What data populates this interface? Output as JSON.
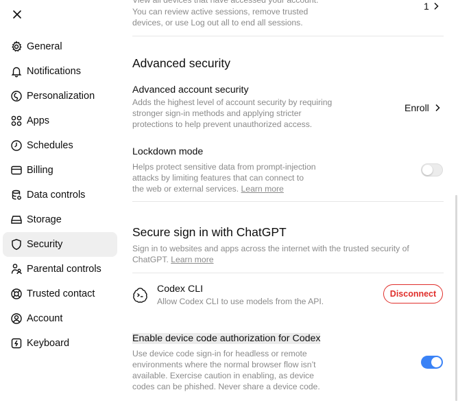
{
  "sidebar": {
    "items": [
      {
        "label": "General",
        "icon": "gear-icon"
      },
      {
        "label": "Notifications",
        "icon": "bell-icon"
      },
      {
        "label": "Personalization",
        "icon": "personalization-icon"
      },
      {
        "label": "Apps",
        "icon": "apps-grid-icon"
      },
      {
        "label": "Schedules",
        "icon": "clock-icon"
      },
      {
        "label": "Billing",
        "icon": "credit-card-icon"
      },
      {
        "label": "Data controls",
        "icon": "database-icon"
      },
      {
        "label": "Storage",
        "icon": "storage-icon"
      },
      {
        "label": "Security",
        "icon": "shield-icon"
      },
      {
        "label": "Parental controls",
        "icon": "parental-icon"
      },
      {
        "label": "Trusted contact",
        "icon": "lifebuoy-icon"
      },
      {
        "label": "Account",
        "icon": "user-circle-icon"
      },
      {
        "label": "Keyboard",
        "icon": "keyboard-icon"
      }
    ],
    "active": "Security"
  },
  "sessions": {
    "desc_line1": "View all devices that have accessed your account.",
    "desc_line2": "You can review active sessions, remove trusted",
    "desc_line3": "devices, or use Log out all to end all sessions.",
    "count": "1"
  },
  "advanced_security": {
    "title": "Advanced security",
    "account_security": {
      "title": "Advanced account security",
      "desc_line1": "Adds the highest level of account security by requiring",
      "desc_line2": "stronger sign-in methods and applying stricter",
      "desc_line3": "protections to help prevent unauthorized access.",
      "action": "Enroll"
    },
    "lockdown": {
      "title": "Lockdown mode",
      "desc_line1": "Helps protect sensitive data from prompt-injection",
      "desc_line2": "attacks by limiting features that can connect to",
      "desc_line3_prefix": "the web or external services. ",
      "learn_more": "Learn more",
      "enabled": false
    }
  },
  "secure_sign_in": {
    "title": "Secure sign in with ChatGPT",
    "desc_line1": "Sign in to websites and apps across the internet with the trusted security of",
    "desc_line2_prefix": "ChatGPT. ",
    "learn_more": "Learn more",
    "codex_cli": {
      "title": "Codex CLI",
      "desc": "Allow Codex CLI to use models from the API.",
      "action": "Disconnect"
    },
    "device_code": {
      "title": "Enable device code authorization for Codex",
      "desc_line1": "Use device code sign-in for headless or remote",
      "desc_line2": "environments where the normal browser flow isn’t",
      "desc_line3": "available. Exercise caution in enabling, as device",
      "desc_line4": "codes can be phished. Never share a device code.",
      "enabled": true
    }
  },
  "colors": {
    "accent": "#3a82f6",
    "danger": "#e02e2a",
    "active_nav_bg": "#efefef"
  }
}
